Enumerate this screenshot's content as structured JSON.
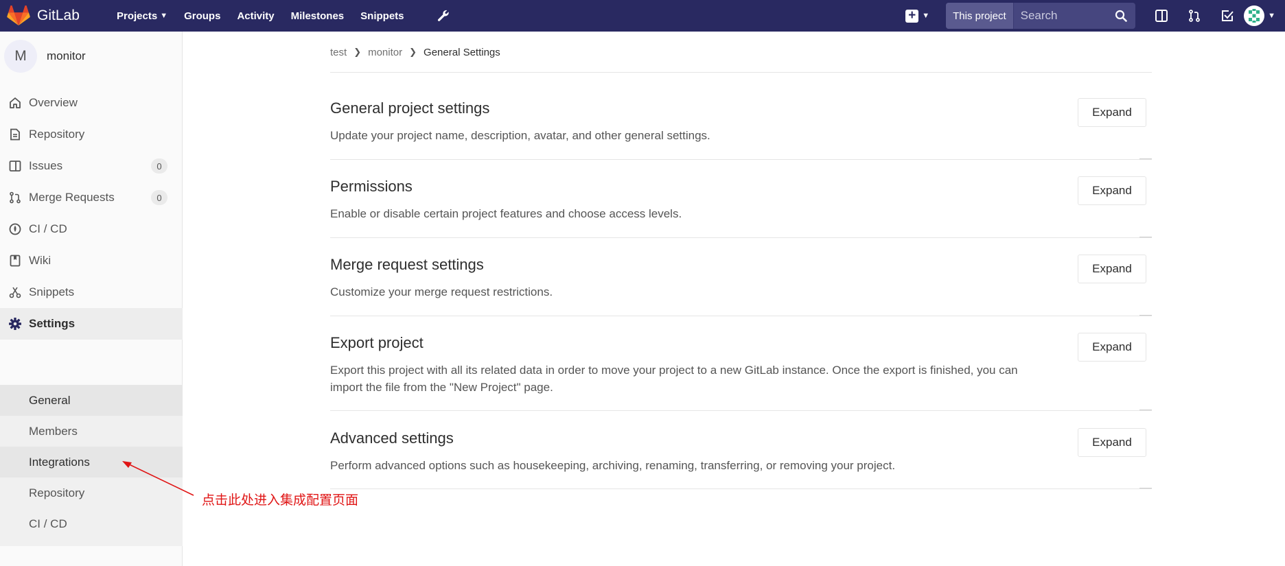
{
  "navbar": {
    "brand": "GitLab",
    "links": [
      {
        "label": "Projects",
        "has_caret": true
      },
      {
        "label": "Groups"
      },
      {
        "label": "Activity"
      },
      {
        "label": "Milestones"
      },
      {
        "label": "Snippets"
      }
    ],
    "search_scope": "This project",
    "search_placeholder": "Search",
    "bg_color": "#292961"
  },
  "sidebar": {
    "project_initial": "M",
    "project_name": "monitor",
    "items": [
      {
        "label": "Overview",
        "icon": "home-icon"
      },
      {
        "label": "Repository",
        "icon": "document-icon"
      },
      {
        "label": "Issues",
        "icon": "issues-icon",
        "count": "0"
      },
      {
        "label": "Merge Requests",
        "icon": "merge-request-icon",
        "count": "0"
      },
      {
        "label": "CI / CD",
        "icon": "rocket-icon"
      },
      {
        "label": "Wiki",
        "icon": "book-icon"
      },
      {
        "label": "Snippets",
        "icon": "scissors-icon"
      },
      {
        "label": "Settings",
        "icon": "gear-icon",
        "active": true
      }
    ],
    "settings_subitems": [
      {
        "label": "General",
        "current": true
      },
      {
        "label": "Members"
      },
      {
        "label": "Integrations"
      },
      {
        "label": "Repository"
      },
      {
        "label": "CI / CD"
      }
    ]
  },
  "breadcrumb": [
    "test",
    "monitor",
    "General Settings"
  ],
  "sections": [
    {
      "title": "General project settings",
      "description": "Update your project name, description, avatar, and other general settings.",
      "button": "Expand"
    },
    {
      "title": "Permissions",
      "description": "Enable or disable certain project features and choose access levels.",
      "button": "Expand"
    },
    {
      "title": "Merge request settings",
      "description": "Customize your merge request restrictions.",
      "button": "Expand"
    },
    {
      "title": "Export project",
      "description": "Export this project with all its related data in order to move your project to a new GitLab instance. Once the export is finished, you can import the file from the \"New Project\" page.",
      "button": "Expand"
    },
    {
      "title": "Advanced settings",
      "description": "Perform advanced options such as housekeeping, archiving, renaming, transferring, or removing your project.",
      "button": "Expand"
    }
  ],
  "annotation": {
    "text": "点击此处进入集成配置页面",
    "color": "#e01515"
  }
}
